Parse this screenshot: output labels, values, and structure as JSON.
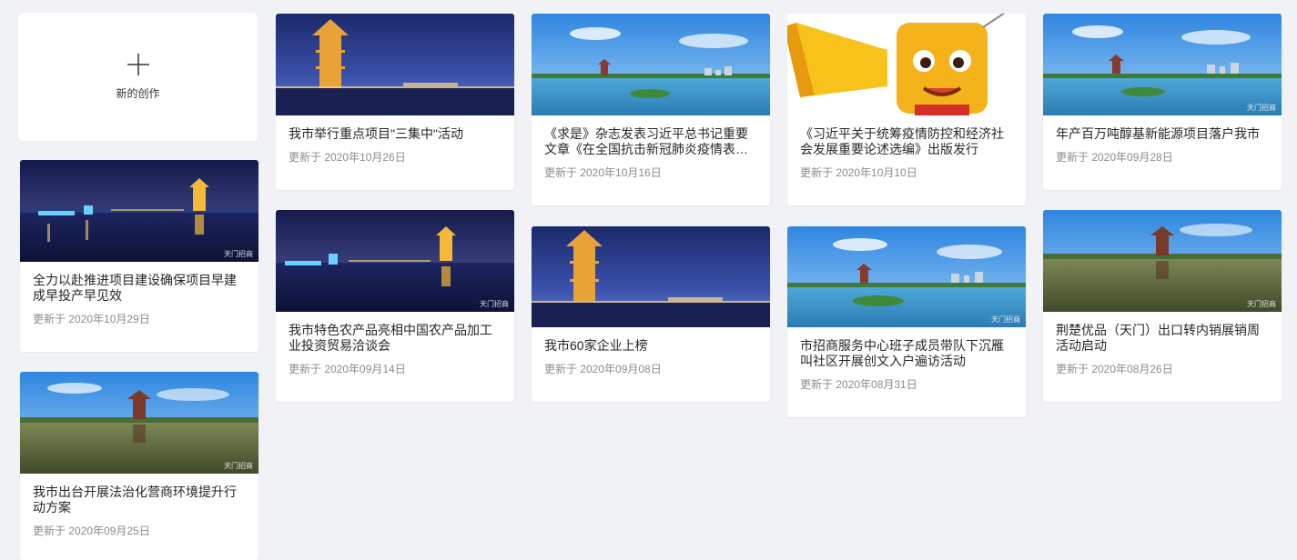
{
  "new_create": {
    "label": "新的创作"
  },
  "watermark": "天门招商",
  "articles": [
    {
      "title": "全力以赴推进项目建设确保项目早建成早投产早见效",
      "date": "更新于 2020年10月29日"
    },
    {
      "title": "我市出台开展法治化营商环境提升行动方案",
      "date": "更新于 2020年09月25日"
    },
    {
      "title": "我市举行重点项目\"三集中\"活动",
      "date": "更新于 2020年10月26日"
    },
    {
      "title": "我市特色农产品亮相中国农产品加工业投资贸易洽谈会",
      "date": "更新于 2020年09月14日"
    },
    {
      "title": "《求是》杂志发表习近平总书记重要文章《在全国抗击新冠肺炎疫情表…",
      "date": "更新于 2020年10月16日"
    },
    {
      "title": "我市60家企业上榜",
      "date": "更新于 2020年09月08日"
    },
    {
      "title": "《习近平关于统筹疫情防控和经济社会发展重要论述选编》出版发行",
      "date": "更新于 2020年10月10日"
    },
    {
      "title": "市招商服务中心班子成员带队下沉雁叫社区开展创文入户遍访活动",
      "date": "更新于 2020年08月31日"
    },
    {
      "title": "年产百万吨醇基新能源项目落户我市",
      "date": "更新于 2020年09月28日"
    },
    {
      "title": "荆楚优品（天门）出口转内销展销周活动启动",
      "date": "更新于 2020年08月26日"
    }
  ]
}
